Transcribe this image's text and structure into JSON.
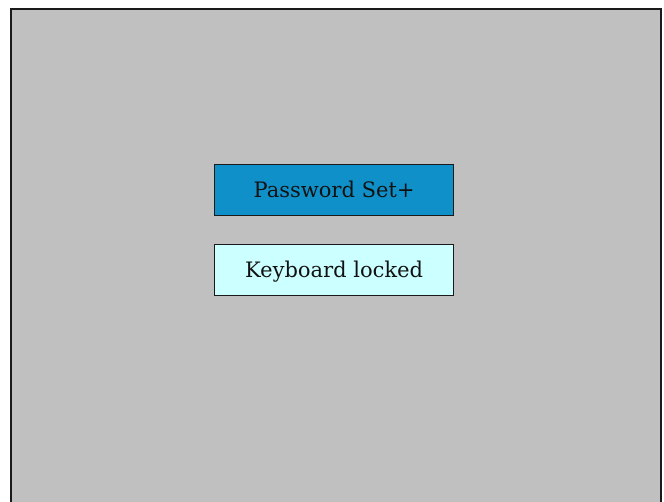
{
  "menu": {
    "items": [
      {
        "label": "Password Set+",
        "selected": true
      },
      {
        "label": "Keyboard locked",
        "selected": false
      }
    ]
  },
  "colors": {
    "background": "#c0c0c0",
    "selected_item": "#1090c8",
    "normal_item": "#ccffff"
  }
}
